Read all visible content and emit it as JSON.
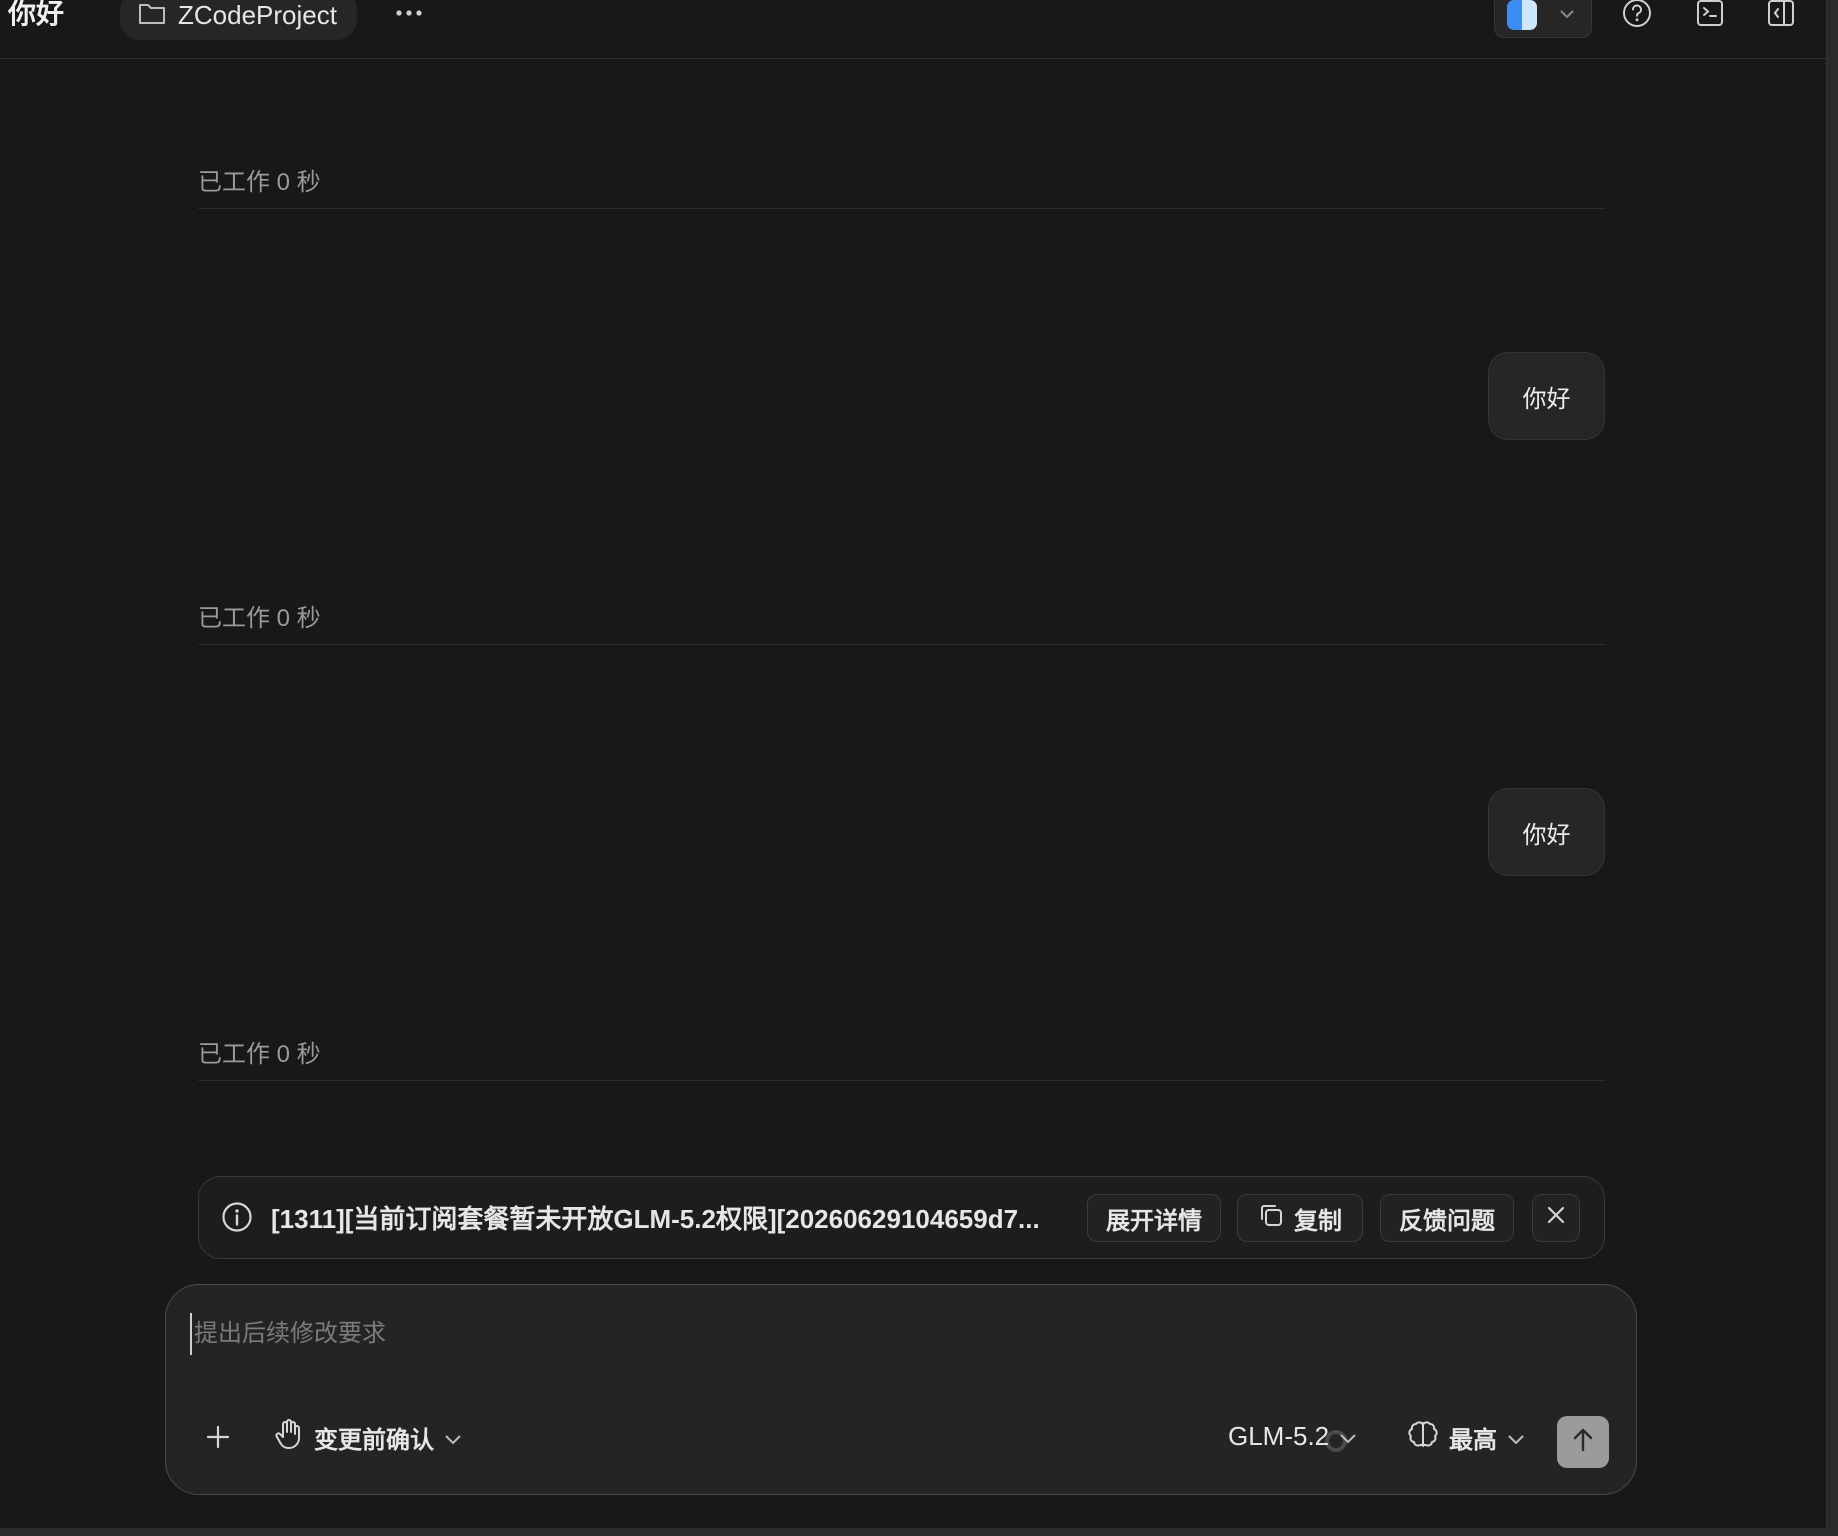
{
  "window": {
    "title": "你好",
    "project_name": "ZCodeProject"
  },
  "chat": {
    "work_status": "已工作 0 秒",
    "user_message": "你好"
  },
  "error_banner": {
    "message": "[1311][当前订阅套餐暂未开放GLM-5.2权限][20260629104659d7...",
    "expand_label": "展开详情",
    "copy_label": "复制",
    "feedback_label": "反馈问题"
  },
  "composer": {
    "placeholder": "提出后续修改要求",
    "mode_label": "变更前确认",
    "model_label": "GLM-5.2",
    "effort_label": "最高"
  }
}
